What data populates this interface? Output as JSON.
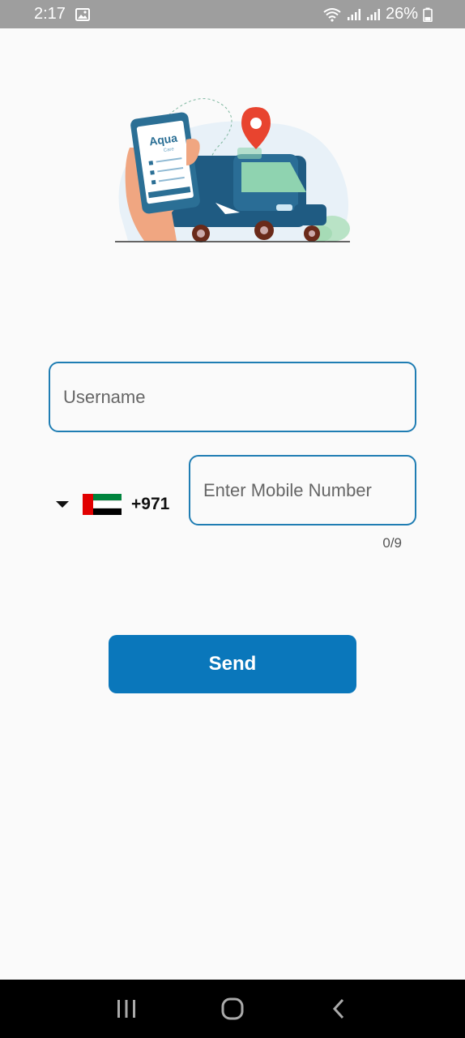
{
  "status_bar": {
    "time": "2:17",
    "battery": "26%",
    "icons": [
      "gallery-icon",
      "wifi-icon",
      "signal-icon",
      "signal-icon",
      "battery-icon"
    ]
  },
  "illustration": {
    "logo_text": "Aqua",
    "logo_subtext": "Care",
    "description_icon": "delivery-truck-illustration"
  },
  "form": {
    "username": {
      "value": "",
      "placeholder": "Username"
    },
    "country": {
      "flag": "uae-flag",
      "dial_code": "+971"
    },
    "mobile": {
      "value": "",
      "placeholder": "Enter Mobile Number",
      "counter": "0/9"
    },
    "send_label": "Send"
  },
  "colors": {
    "accent": "#0a77bb",
    "border": "#1f7db3",
    "background": "#fafafa",
    "status_bar": "#9e9e9e"
  },
  "nav": {
    "buttons": [
      "recent-apps-icon",
      "home-icon",
      "back-icon"
    ]
  }
}
